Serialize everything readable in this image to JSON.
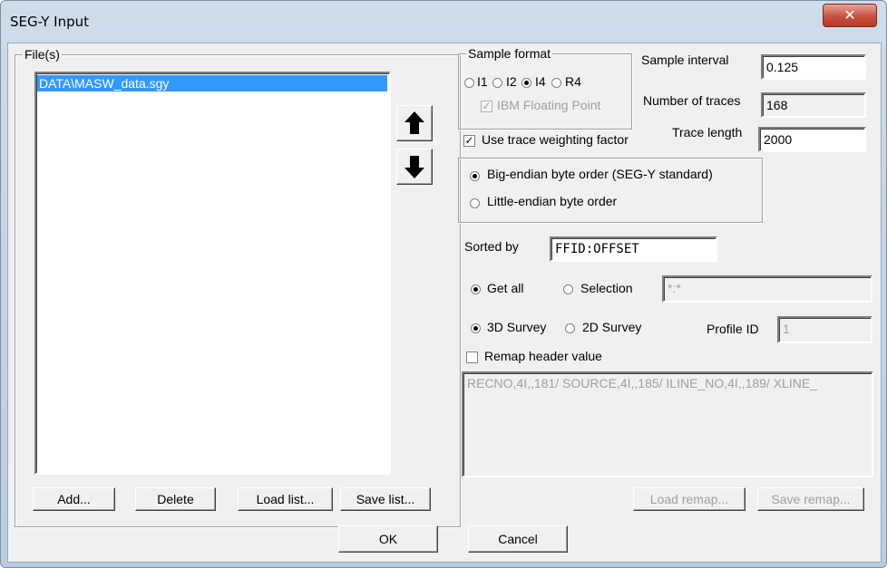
{
  "window": {
    "title": "SEG-Y Input",
    "close_icon": "close-icon"
  },
  "files": {
    "group_label": "File(s)",
    "items": [
      "DATA\\MASW_data.sgy"
    ],
    "add_label": "Add...",
    "delete_label": "Delete",
    "load_list_label": "Load list...",
    "save_list_label": "Save list..."
  },
  "icons": {
    "move_up": "arrow-up-icon",
    "move_down": "arrow-down-icon"
  },
  "sample_format": {
    "group_label": "Sample format",
    "options": [
      "I1",
      "I2",
      "I4",
      "R4"
    ],
    "selected": "I4",
    "ibm_label": "IBM Floating Point",
    "ibm_checked": true
  },
  "sample_interval": {
    "label": "Sample interval",
    "value": "0.125"
  },
  "number_of_traces": {
    "label": "Number of traces",
    "value": "168"
  },
  "trace_length": {
    "label": "Trace length",
    "value": "2000"
  },
  "weighting": {
    "label": "Use trace weighting factor",
    "checked": true
  },
  "byte_order": {
    "big_label": "Big-endian byte order (SEG-Y standard)",
    "little_label": "Little-endian byte order",
    "selected": "big"
  },
  "sorted_by": {
    "label": "Sorted by",
    "value": "FFID:OFFSET"
  },
  "selection": {
    "get_all_label": "Get all",
    "selection_label": "Selection",
    "value": "*:*",
    "selected": "get_all"
  },
  "survey": {
    "label_3d": "3D Survey",
    "label_2d": "2D Survey",
    "profile_label": "Profile ID",
    "profile_value": "1",
    "selected": "3d"
  },
  "remap": {
    "label": "Remap header value",
    "checked": false,
    "text": "RECNO,4I,,181/ SOURCE,4I,,185/ ILINE_NO,4I,,189/ XLINE_",
    "load_label": "Load remap...",
    "save_label": "Save remap..."
  },
  "footer": {
    "ok_label": "OK",
    "cancel_label": "Cancel"
  }
}
